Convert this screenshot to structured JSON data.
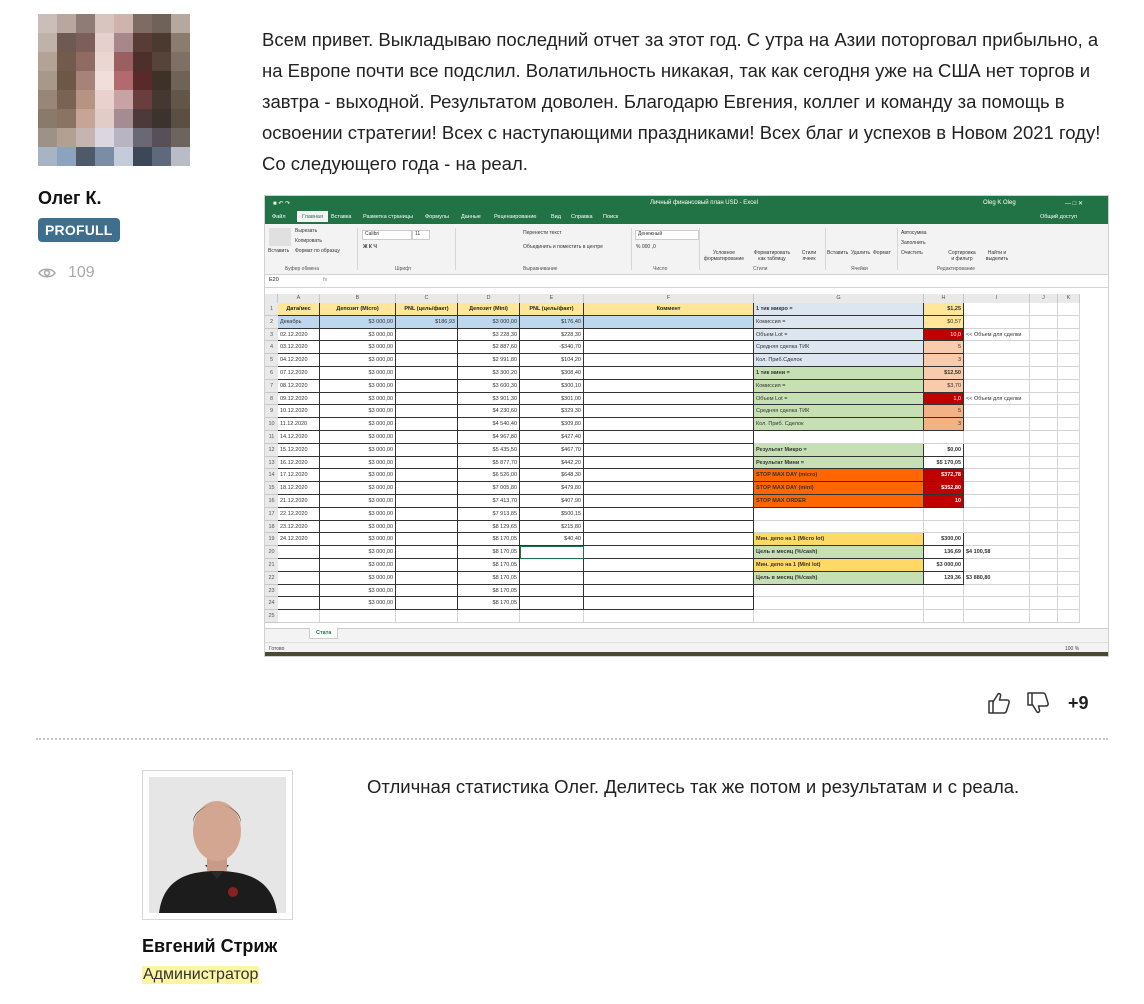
{
  "post1": {
    "author": "Олег К.",
    "badge": "PROFULL",
    "views": "109",
    "text": "Всем привет. Выкладываю последний отчет за этот год. С утра на Азии поторговал прибыльно, а на Европе почти все подслил. Волатильность никакая, так как сегодня уже на США нет торгов и завтра - выходной. Результатом доволен. Благодарю Евгения, коллег и команду за помощь в освоении стратегии! Всех с наступающими праздниками! Всех благ и успехов в Новом 2021 году! Со следующего года - на реал.",
    "icons": {
      "views": "eye-icon",
      "like": "thumbs-up-icon",
      "dislike": "thumbs-down-icon"
    },
    "score": "+9"
  },
  "excel": {
    "window_title": "Личный финансовый план USD - Excel",
    "user": "Oleg K Oleg",
    "tabs": [
      "Файл",
      "Главная",
      "Вставка",
      "Разметка страницы",
      "Формулы",
      "Данные",
      "Рецензирование",
      "Вид",
      "Справка",
      "Поиск"
    ],
    "share": "Общий доступ",
    "ribbon": {
      "paste": "Вставить",
      "cut": "Вырезать",
      "copy": "Копировать",
      "format_painter": "Формат по образцу",
      "font": "Calibri",
      "font_size": "11",
      "wrap": "Перенести текст",
      "merge": "Объединить и поместить в центре",
      "number_format": "Денежный",
      "cond_format": "Условное форматирование",
      "format_table": "Форматировать как таблицу",
      "cell_styles": "Стили ячеек",
      "insert": "Вставить",
      "delete": "Удалить",
      "format": "Формат",
      "autosum": "Автосумма",
      "fill": "Заполнить",
      "clear": "Очистить",
      "sort": "Сортировка и фильтр",
      "find": "Найти и выделить",
      "groups": [
        "Буфер обмена",
        "Шрифт",
        "Выравнивание",
        "Число",
        "Стили",
        "Ячейки",
        "Редактирование"
      ]
    },
    "name_box": "E20",
    "columns": [
      "A",
      "B",
      "C",
      "D",
      "E",
      "F",
      "G",
      "H",
      "I",
      "J",
      "K"
    ],
    "headers": [
      "Дата/мес",
      "Депозит (Micro)",
      "PNL (цель/факт)",
      "Депозит (Mini)",
      "PNL (цель/факт)",
      "Коммент"
    ],
    "rows": [
      [
        "Декабрь",
        "$3 000,00",
        "$186,93",
        "$3 000,00",
        "$176,40"
      ],
      [
        "02.12.2020",
        "$3 000,00",
        "",
        "$3 228,30",
        "$228,30"
      ],
      [
        "03.12.2020",
        "$3 000,00",
        "",
        "$2 887,60",
        "-$340,70"
      ],
      [
        "04.12.2020",
        "$3 000,00",
        "",
        "$2 991,80",
        "$104,20"
      ],
      [
        "07.12.2020",
        "$3 000,00",
        "",
        "$3 300,20",
        "$308,40"
      ],
      [
        "08.12.2020",
        "$3 000,00",
        "",
        "$3 600,30",
        "$300,10"
      ],
      [
        "09.12.2020",
        "$3 000,00",
        "",
        "$3 901,30",
        "$301,00"
      ],
      [
        "10.12.2020",
        "$3 000,00",
        "",
        "$4 230,60",
        "$329,30"
      ],
      [
        "11.12.2020",
        "$3 000,00",
        "",
        "$4 540,40",
        "$309,80"
      ],
      [
        "14.12.2020",
        "$3 000,00",
        "",
        "$4 967,80",
        "$427,40"
      ],
      [
        "15.12.2020",
        "$3 000,00",
        "",
        "$5 435,50",
        "$467,70"
      ],
      [
        "16.12.2020",
        "$3 000,00",
        "",
        "$5 877,70",
        "$442,20"
      ],
      [
        "17.12.2020",
        "$3 000,00",
        "",
        "$6 526,00",
        "$648,30"
      ],
      [
        "18.12.2020",
        "$3 000,00",
        "",
        "$7 005,80",
        "$479,80"
      ],
      [
        "21.12.2020",
        "$3 000,00",
        "",
        "$7 413,70",
        "$407,90"
      ],
      [
        "22.12.2020",
        "$3 000,00",
        "",
        "$7 913,85",
        "$500,15"
      ],
      [
        "23.12.2020",
        "$3 000,00",
        "",
        "$8 129,65",
        "$215,80"
      ],
      [
        "24.12.2020",
        "$3 000,00",
        "",
        "$8 170,05",
        "$40,40"
      ],
      [
        "",
        "$3 000,00",
        "",
        "$8 170,05",
        ""
      ],
      [
        "",
        "$3 000,00",
        "",
        "$8 170,05",
        ""
      ],
      [
        "",
        "$3 000,00",
        "",
        "$8 170,05",
        ""
      ],
      [
        "",
        "$3 000,00",
        "",
        "$8 170,05",
        ""
      ],
      [
        "",
        "$3 000,00",
        "",
        "$8 170,05",
        ""
      ]
    ],
    "side": [
      {
        "row": 1,
        "label": "1 тик микро =",
        "value": "$1,25",
        "bg": "#dce6f1",
        "vbg": "#ffe699",
        "bold": true
      },
      {
        "row": 2,
        "label": "Комиссия =",
        "value": "$0,57",
        "bg": "#dce6f1",
        "vbg": "#ffe699"
      },
      {
        "row": 3,
        "label": "Объем  Lot =",
        "value": "10,0",
        "bg": "#dce6f1",
        "vbg": "#c00000",
        "vcolor": "#ffffff",
        "note": "<< Объем для сделки"
      },
      {
        "row": 4,
        "label": "Средняя сделка ТИК",
        "value": "5",
        "bg": "#dce6f1",
        "vbg": "#f8cbad"
      },
      {
        "row": 5,
        "label": "Кол. Приб.Сделок",
        "value": "3",
        "bg": "#dce6f1",
        "vbg": "#f8cbad"
      },
      {
        "row": 6,
        "label": "1 тик мини =",
        "value": "$12,50",
        "bg": "#c6e0b4",
        "vbg": "#f8cbad",
        "bold": true
      },
      {
        "row": 7,
        "label": "Комиссия =",
        "value": "$3,70",
        "bg": "#c6e0b4",
        "vbg": "#f8cbad"
      },
      {
        "row": 8,
        "label": "Объем  Lot =",
        "value": "1,0",
        "bg": "#c6e0b4",
        "vbg": "#c00000",
        "vcolor": "#ffffff",
        "note": "<< Объем для сделки"
      },
      {
        "row": 9,
        "label": "Средняя сделка ТИК",
        "value": "5",
        "bg": "#c6e0b4",
        "vbg": "#f4b183"
      },
      {
        "row": 10,
        "label": "Кол. Приб. Сделок",
        "value": "3",
        "bg": "#c6e0b4",
        "vbg": "#f4b183"
      },
      {
        "row": 12,
        "label": "Результат Микро =",
        "value": "$0,00",
        "bg": "#c6e0b4",
        "vbg": "#ffffff",
        "bold": true
      },
      {
        "row": 13,
        "label": "Результат Мини =",
        "value": "$5 170,05",
        "bg": "#c6e0b4",
        "vbg": "#ffffff",
        "bold": true
      },
      {
        "row": 14,
        "label": "STOP MAX DAY (micro)",
        "value": "$372,78",
        "bg": "#ff6600",
        "vbg": "#c00000",
        "vcolor": "#ffffff",
        "bold": true
      },
      {
        "row": 15,
        "label": "STOP MAX DAY (mini)",
        "value": "$352,80",
        "bg": "#ff6600",
        "vbg": "#c00000",
        "vcolor": "#ffffff",
        "bold": true
      },
      {
        "row": 16,
        "label": "STOP MAX ORDER",
        "value": "10",
        "bg": "#ff6600",
        "vbg": "#c00000",
        "vcolor": "#ffffff",
        "bold": true
      },
      {
        "row": 19,
        "label": "Мин. депо на 1 (Micro lot)",
        "value": "$300,00",
        "bg": "#ffd966",
        "vbg": "#ffffff",
        "bold": true
      },
      {
        "row": 20,
        "label": "Цель в месяц (%/cash)",
        "value": "136,69",
        "bg": "#c6e0b4",
        "vbg": "#ffffff",
        "bold": true,
        "extra": "$4 100,58"
      },
      {
        "row": 21,
        "label": "Мин. депо на 1 (Mini lot)",
        "value": "$3 000,00",
        "bg": "#ffd966",
        "vbg": "#ffffff",
        "bold": true
      },
      {
        "row": 22,
        "label": "Цель в месяц (%/cash)",
        "value": "129,36",
        "bg": "#c6e0b4",
        "vbg": "#ffffff",
        "bold": true,
        "extra": "$3 880,80"
      }
    ],
    "sheet_tab": "Стата",
    "status_left": "Готово",
    "zoom": "100 %"
  },
  "post2": {
    "author": "Евгений Стриж",
    "role": "Администратор",
    "text": "Отличная статистика Олег. Делитесь так же потом и результатам и с реала."
  }
}
